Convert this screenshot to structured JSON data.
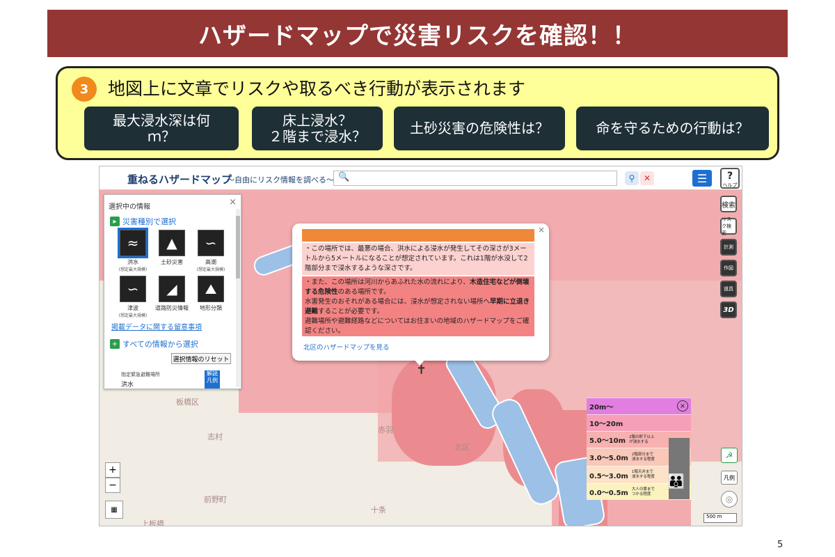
{
  "slide": {
    "title": "ハザードマップで災害リスクを確認！！",
    "page_number": "5"
  },
  "callout": {
    "step_number": "3",
    "text": "地図上に文章でリスクや取るべき行動が表示されます",
    "questions": [
      {
        "label": "最大浸水深は何\nｍ？"
      },
      {
        "label": "床上浸水？\n２階まで浸水？"
      },
      {
        "label": "土砂災害の危険性は？"
      },
      {
        "label": "命を守るための行動は？"
      }
    ]
  },
  "app": {
    "title": "重ねるハザードマップ",
    "subtitle": "～自由にリスク情報を調べる～",
    "help_label": "ヘルプ"
  },
  "panel": {
    "title": "選択中の情報",
    "section1": "災害種別で選択",
    "hazards": [
      {
        "icon": "flood-icon",
        "label": "洪水",
        "note": "(想定最大規模)"
      },
      {
        "icon": "landslide-icon",
        "label": "土砂災害",
        "note": ""
      },
      {
        "icon": "storm-surge-icon",
        "label": "高潮",
        "note": "(想定最大規模)"
      },
      {
        "icon": "tsunami-icon",
        "label": "津波",
        "note": "(想定最大規模)"
      },
      {
        "icon": "road-disaster-icon",
        "label": "道路防災情報",
        "note": ""
      },
      {
        "icon": "terrain-icon",
        "label": "地形分類",
        "note": ""
      }
    ],
    "notice_link": "掲載データに関する留意事項",
    "section2": "すべての情報から選択",
    "reset_label": "選択情報のリセット",
    "shelter_label": "指定緊急避難場所",
    "shelter_value": "洪水",
    "kaisetsu_label": "解説\n凡例"
  },
  "popup": {
    "text1": "・この場所では、最悪の場合、洪水による浸水が発生してその深さが3メートルから5メートルになることが想定されています。これは1階が水没して2階部分まで浸水するような深さです。",
    "text2a": "・また、この場所は河川からあふれた水の流れにより、",
    "text2b": "木造住宅などが倒壊する危険性",
    "text2c": "のある場所です。",
    "text2d": "水害発生のおそれがある場合には、浸水が想定されない場所へ",
    "text2e": "早期に立退き避難",
    "text2f": "することが必要です。",
    "text2g": "避難場所や避難経路などについてはお住まいの地域のハザードマップをご確認ください。",
    "link": "北区のハザードマップを見る"
  },
  "legend": {
    "rows": [
      {
        "label": "20m～",
        "desc": "",
        "color": "#e27ee0"
      },
      {
        "label": "10～20m",
        "desc": "",
        "color": "#f59fb8"
      },
      {
        "label": "5.0～10m",
        "desc": "2階の軒下以上\nが浸水する",
        "color": "#f7b1b0"
      },
      {
        "label": "3.0～5.0m",
        "desc": "2階部分まで\n浸水する程度",
        "color": "#f9c8b8"
      },
      {
        "label": "0.5～3.0m",
        "desc": "1階天井まで\n浸水する程度",
        "color": "#fde2c8"
      },
      {
        "label": "0.0～0.5m",
        "desc": "大人の膝まで\nつかる程度",
        "color": "#fbf2c0"
      }
    ]
  },
  "map": {
    "scale": "500 m",
    "legend_button": "凡例",
    "labels": [
      "板橋区",
      "赤羽",
      "北区",
      "十条",
      "前野町",
      "上板橋",
      "志村"
    ]
  },
  "tools": [
    "検索",
    "リスク検索",
    "計測",
    "作図",
    "道具",
    "3D"
  ]
}
